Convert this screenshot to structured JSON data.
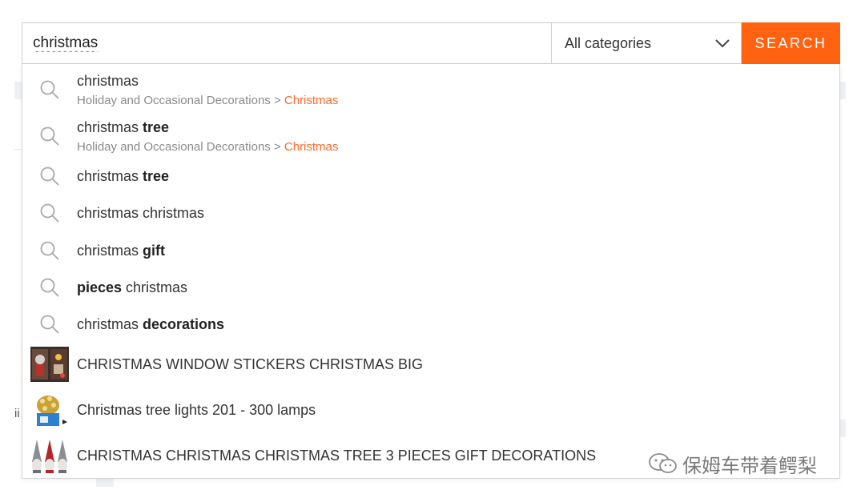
{
  "search": {
    "query": "christmas",
    "category": "All categories",
    "button_label": "SEARCH"
  },
  "suggestions": [
    {
      "prefix": "christmas",
      "bold": "",
      "suffix": "",
      "category_path": "Holiday and Occasional Decorations > ",
      "category_highlight": "Christmas"
    },
    {
      "prefix": "christmas ",
      "bold": "tree",
      "suffix": "",
      "category_path": "Holiday and Occasional Decorations > ",
      "category_highlight": "Christmas"
    },
    {
      "prefix": "christmas ",
      "bold": "tree",
      "suffix": ""
    },
    {
      "prefix": "christmas christmas",
      "bold": "",
      "suffix": ""
    },
    {
      "prefix": "christmas ",
      "bold": "gift",
      "suffix": ""
    },
    {
      "prefix": "",
      "bold": "pieces",
      "suffix": " christmas"
    },
    {
      "prefix": "christmas ",
      "bold": "decorations",
      "suffix": ""
    }
  ],
  "products": [
    {
      "title": "CHRISTMAS WINDOW STICKERS CHRISTMAS BIG",
      "thumb_icon": "window-stickers-thumbnail"
    },
    {
      "title": "Christmas tree lights 201 - 300 lamps",
      "thumb_icon": "tree-lights-thumbnail"
    },
    {
      "title": "CHRISTMAS CHRISTMAS CHRISTMAS TREE 3 PIECES GIFT DECORATIONS",
      "thumb_icon": "gnome-decorations-thumbnail"
    }
  ],
  "background_fragment": "ii",
  "watermark": {
    "text": "保姆车带着鳄梨",
    "icon": "wechat-logo-icon"
  },
  "colors": {
    "accent": "#ff6211",
    "category_highlight": "#ff6a2b"
  }
}
